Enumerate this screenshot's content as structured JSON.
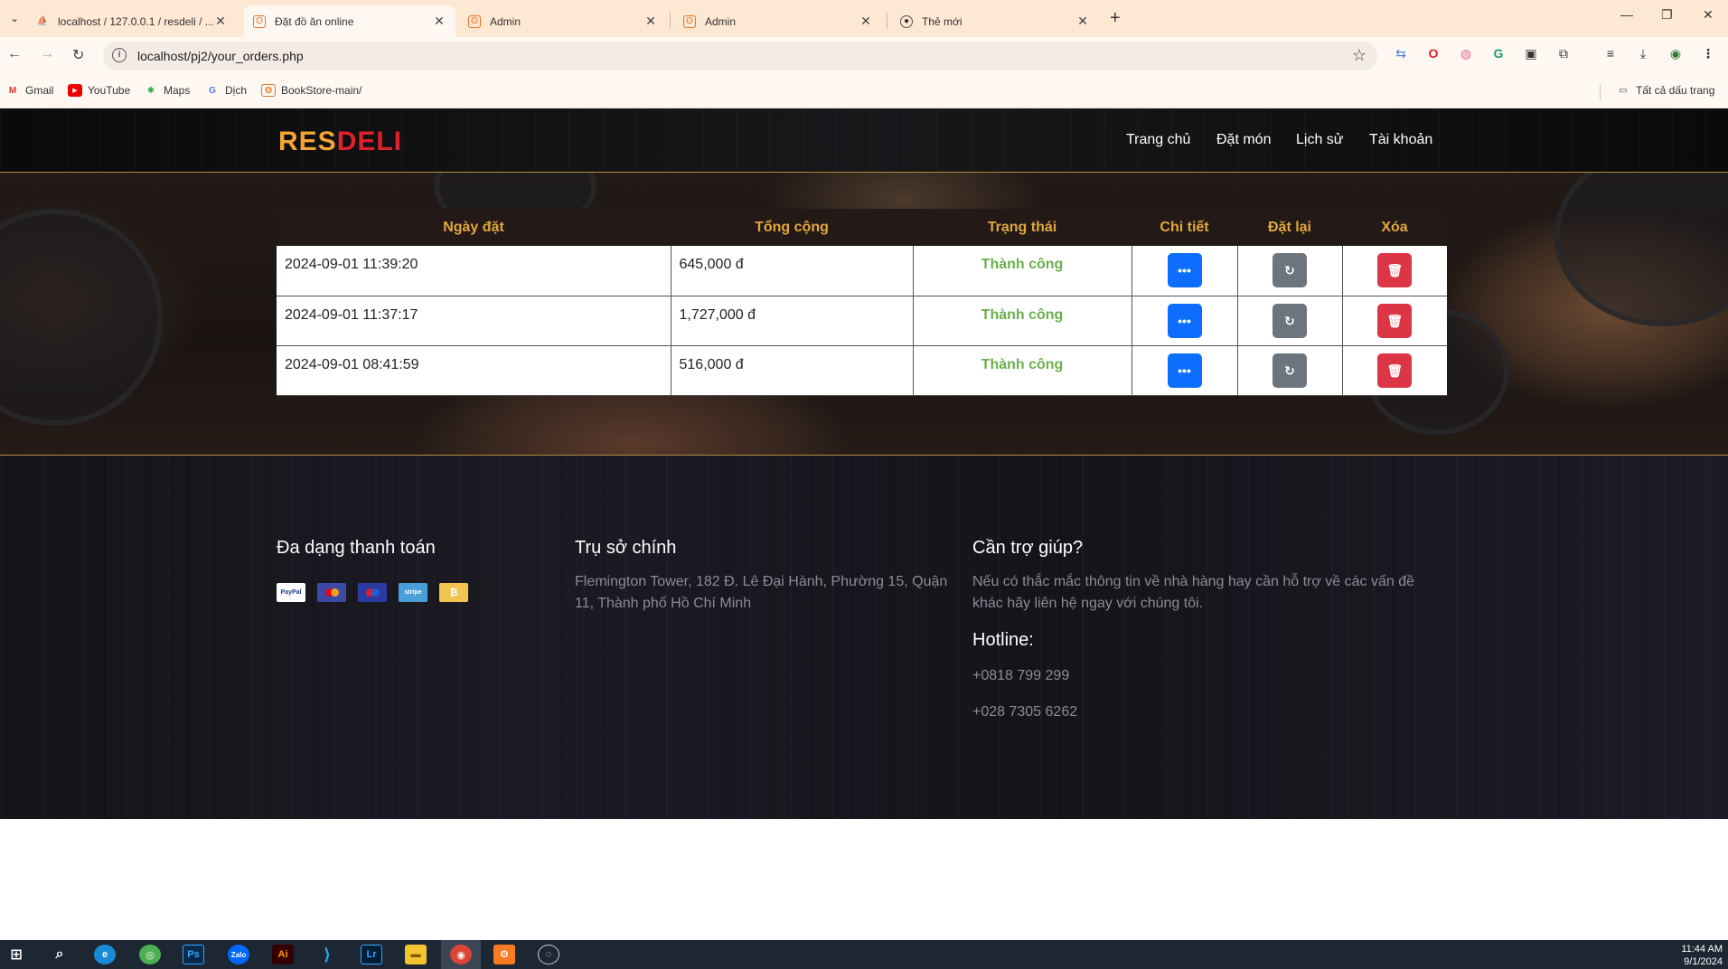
{
  "browser": {
    "tabs": [
      {
        "title": "localhost / 127.0.0.1 / resdeli / ...",
        "icon": "phpmyadmin-icon",
        "active": false
      },
      {
        "title": "Đặt đồ ăn online",
        "icon": "xampp-icon",
        "active": true
      },
      {
        "title": "Admin",
        "icon": "xampp-icon",
        "active": false
      },
      {
        "title": "Admin",
        "icon": "xampp-icon",
        "active": false
      },
      {
        "title": "Thẻ mới",
        "icon": "chrome-icon",
        "active": false
      }
    ],
    "url": "localhost/pj2/your_orders.php",
    "bookmarks": [
      {
        "label": "Gmail",
        "icon": "gmail-icon"
      },
      {
        "label": "YouTube",
        "icon": "youtube-icon"
      },
      {
        "label": "Maps",
        "icon": "maps-icon"
      },
      {
        "label": "Dịch",
        "icon": "translate-icon"
      },
      {
        "label": "BookStore-main/",
        "icon": "xampp-icon"
      }
    ],
    "all_bookmarks": "Tất cả dấu trang"
  },
  "site": {
    "logo_part1": "RES",
    "logo_part2": "DELI",
    "nav": [
      "Trang chủ",
      "Đặt món",
      "Lịch sử",
      "Tài khoản"
    ]
  },
  "orders": {
    "headers": [
      "Ngày đặt",
      "Tổng cộng",
      "Trạng thái",
      "Chi tiết",
      "Đặt lại",
      "Xóa"
    ],
    "rows": [
      {
        "date": "2024-09-01 11:39:20",
        "total": "645,000 đ",
        "status": "Thành công"
      },
      {
        "date": "2024-09-01 11:37:17",
        "total": "1,727,000 đ",
        "status": "Thành công"
      },
      {
        "date": "2024-09-01 08:41:59",
        "total": "516,000 đ",
        "status": "Thành công"
      }
    ],
    "colors": {
      "details": "#0d6efd",
      "reorder": "#6c757d",
      "delete": "#dc3545",
      "status": "#6ab04c",
      "header_text": "#e3a73d"
    }
  },
  "footer": {
    "payments_title": "Đa dạng thanh toán",
    "payments": [
      "PayPal",
      "MasterCard",
      "Maestro",
      "stripe",
      "Bitcoin"
    ],
    "hq_title": "Trụ sở chính",
    "hq_address": "Flemington Tower, 182 Đ. Lê Đại Hành, Phường 15, Quận 11, Thành phố Hồ Chí Minh",
    "help_title": "Cần trợ giúp?",
    "help_text": "Nếu có thắc mắc thông tin về nhà hàng hay cần hỗ trợ về các vấn đề khác hãy liên hệ ngay với chúng tôi.",
    "hotline_title": "Hotline:",
    "hotline_1": "+0818 799 299",
    "hotline_2": "+028 7305 6262"
  },
  "taskbar": {
    "time": "11:44 AM",
    "date": "9/1/2024"
  }
}
